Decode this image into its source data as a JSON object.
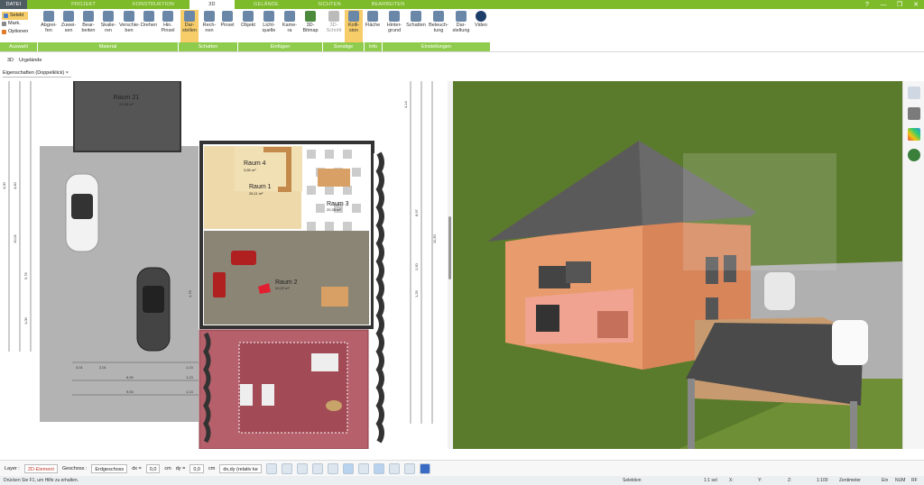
{
  "tabs": [
    "DATEI",
    "PROJEKT",
    "KONSTRUKTION",
    "3D",
    "GELÄNDE",
    "SICHTEN",
    "BEARBEITEN"
  ],
  "window_controls": [
    "?",
    "—",
    "❐",
    "✕"
  ],
  "auswahl": {
    "select": "Selekt",
    "mark": "Mark.",
    "options": "Optionen"
  },
  "ribbon_buttons": [
    {
      "label": "Abgrei-fen"
    },
    {
      "label": "Zuwei-sen"
    },
    {
      "label": "Bear-beiten"
    },
    {
      "label": "Skalie-ren"
    },
    {
      "label": "Verschie-ben"
    },
    {
      "label": "Drehen"
    },
    {
      "label": "Hin. Pinsel"
    },
    {
      "label": "Dar-stellen"
    },
    {
      "label": "Rech-nen"
    },
    {
      "label": "Pinsel"
    },
    {
      "label": "Objekt"
    },
    {
      "label": "Licht-quelle"
    },
    {
      "label": "Kame-ra"
    },
    {
      "label": "3D-Bitmap"
    },
    {
      "label": "3D-Schnitt"
    },
    {
      "label": "Kolli-sion"
    },
    {
      "label": "Fläche"
    },
    {
      "label": "Hinter-grund"
    },
    {
      "label": "Schatten"
    },
    {
      "label": "Beleuch-tung"
    },
    {
      "label": "Dar-stellung"
    },
    {
      "label": "Video"
    }
  ],
  "groups": [
    "Auswahl",
    "Material",
    "Schatten",
    "Einfügen",
    "Sonstige",
    "Info",
    "Einstellungen"
  ],
  "layerbar": {
    "mode": "3D",
    "terrain": "Urgelände"
  },
  "properties_tab": "Eigenschaften (Doppelklick)",
  "rooms": [
    {
      "name": "Raum 21",
      "area": "22,05 m²"
    },
    {
      "name": "Raum 4",
      "area": "3,85 m²"
    },
    {
      "name": "Raum 1",
      "area": "26,11 m²"
    },
    {
      "name": "Raum 3",
      "area": "20,35 m²"
    },
    {
      "name": "Raum 2",
      "area": "20,22 m²"
    }
  ],
  "dims": {
    "left": [
      "4,00",
      "10,01",
      "5,76",
      "1,00",
      "4,60",
      "1,76"
    ],
    "right": [
      "4,14",
      "11,30",
      "8,97",
      "2,50",
      "1,25"
    ],
    "bottom": [
      "3,01",
      "2,01",
      "1,13",
      "6,00",
      "1,13",
      "9,00",
      "1,13"
    ]
  },
  "bottombar": {
    "layer_label": "Layer :",
    "layer_value": "2D-Element",
    "floor_label": "Geschoss :",
    "floor_value": "Erdgeschoss",
    "dx_label": "dx =",
    "dx_value": "0,0",
    "dy_label": "dy =",
    "dy_value": "0,0",
    "unit": "cm",
    "mode": "dx,dy (relativ ke"
  },
  "status": {
    "help": "Drücken Sie F1, um Hilfe zu erhalten.",
    "selection": "Selektion",
    "scale_sel": "1:1 sel",
    "x": "X:",
    "y": "Y:",
    "z": "Z:",
    "scale": "1:100",
    "unit": "Zentimeter",
    "ein": "Ein",
    "num": "NUM",
    "rf": "RF"
  },
  "colors": {
    "green": "#7dbb2a",
    "accent": "#f7cd6a",
    "grass": "#5a7c2a"
  }
}
